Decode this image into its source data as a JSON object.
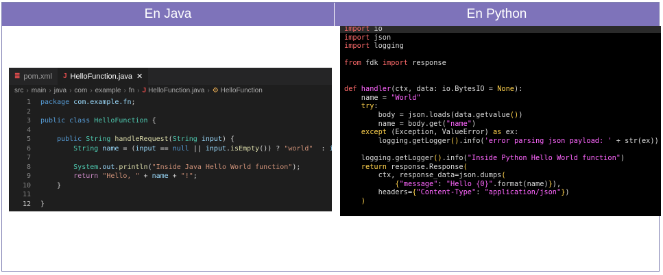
{
  "header": {
    "left_title": "En Java",
    "right_title": "En Python"
  },
  "java": {
    "tabs": [
      {
        "icon": "xml-file-icon",
        "glyph": "≣",
        "label": "pom.xml",
        "color": "#e44d4d"
      },
      {
        "icon": "java-file-icon",
        "glyph": "J",
        "label": "HelloFunction.java",
        "color": "#e44d4d"
      }
    ],
    "close_glyph": "✕",
    "breadcrumb": [
      "src",
      "main",
      "java",
      "com",
      "example",
      "fn",
      "HelloFunction.java",
      "HelloFunction"
    ],
    "current_line": 12,
    "lines": [
      {
        "num": "1",
        "tokens": [
          {
            "t": "package ",
            "c": "#569cd6"
          },
          {
            "t": "com.example.fn",
            "c": "#9cdcfe"
          },
          {
            "t": ";",
            "c": "#d4d4d4"
          }
        ]
      },
      {
        "num": "2",
        "tokens": []
      },
      {
        "num": "3",
        "tokens": [
          {
            "t": "public class ",
            "c": "#569cd6"
          },
          {
            "t": "HelloFunction",
            "c": "#4ec9b0"
          },
          {
            "t": " {",
            "c": "#d4d4d4"
          }
        ]
      },
      {
        "num": "4",
        "tokens": []
      },
      {
        "num": "5",
        "tokens": [
          {
            "t": "    public ",
            "c": "#569cd6"
          },
          {
            "t": "String ",
            "c": "#4ec9b0"
          },
          {
            "t": "handleRequest",
            "c": "#dcdcaa"
          },
          {
            "t": "(",
            "c": "#d4d4d4"
          },
          {
            "t": "String ",
            "c": "#4ec9b0"
          },
          {
            "t": "input",
            "c": "#9cdcfe"
          },
          {
            "t": ") {",
            "c": "#d4d4d4"
          }
        ]
      },
      {
        "num": "6",
        "tokens": [
          {
            "t": "        String ",
            "c": "#4ec9b0"
          },
          {
            "t": "name",
            "c": "#9cdcfe"
          },
          {
            "t": " = (",
            "c": "#d4d4d4"
          },
          {
            "t": "input",
            "c": "#9cdcfe"
          },
          {
            "t": " == ",
            "c": "#d4d4d4"
          },
          {
            "t": "null",
            "c": "#569cd6"
          },
          {
            "t": " || ",
            "c": "#d4d4d4"
          },
          {
            "t": "input",
            "c": "#9cdcfe"
          },
          {
            "t": ".",
            "c": "#d4d4d4"
          },
          {
            "t": "isEmpty",
            "c": "#dcdcaa"
          },
          {
            "t": "()) ? ",
            "c": "#d4d4d4"
          },
          {
            "t": "\"world\"",
            "c": "#ce9178"
          },
          {
            "t": "  : ",
            "c": "#d4d4d4"
          },
          {
            "t": "input",
            "c": "#9cdcfe"
          },
          {
            "t": ";",
            "c": "#d4d4d4"
          }
        ]
      },
      {
        "num": "7",
        "tokens": []
      },
      {
        "num": "8",
        "tokens": [
          {
            "t": "        System",
            "c": "#4ec9b0"
          },
          {
            "t": ".",
            "c": "#d4d4d4"
          },
          {
            "t": "out",
            "c": "#9cdcfe"
          },
          {
            "t": ".",
            "c": "#d4d4d4"
          },
          {
            "t": "println",
            "c": "#dcdcaa"
          },
          {
            "t": "(",
            "c": "#d4d4d4"
          },
          {
            "t": "\"Inside Java Hello World function\"",
            "c": "#ce9178"
          },
          {
            "t": ");",
            "c": "#d4d4d4"
          }
        ]
      },
      {
        "num": "9",
        "tokens": [
          {
            "t": "        return ",
            "c": "#c586c0"
          },
          {
            "t": "\"Hello, \"",
            "c": "#ce9178"
          },
          {
            "t": " + ",
            "c": "#d4d4d4"
          },
          {
            "t": "name",
            "c": "#9cdcfe"
          },
          {
            "t": " + ",
            "c": "#d4d4d4"
          },
          {
            "t": "\"!\"",
            "c": "#ce9178"
          },
          {
            "t": ";",
            "c": "#d4d4d4"
          }
        ]
      },
      {
        "num": "10",
        "tokens": [
          {
            "t": "    }",
            "c": "#d4d4d4"
          }
        ]
      },
      {
        "num": "11",
        "tokens": []
      },
      {
        "num": "12",
        "tokens": [
          {
            "t": "}",
            "c": "#d4d4d4"
          }
        ]
      }
    ]
  },
  "python": {
    "lines": [
      [
        {
          "t": "import",
          "c": "#ff6b6b"
        },
        {
          "t": " io",
          "c": "#d9d9d9"
        }
      ],
      [
        {
          "t": "import",
          "c": "#ff6b6b"
        },
        {
          "t": " json",
          "c": "#d9d9d9"
        }
      ],
      [
        {
          "t": "import",
          "c": "#ff6b6b"
        },
        {
          "t": " logging",
          "c": "#d9d9d9"
        }
      ],
      [],
      [
        {
          "t": "from",
          "c": "#ff6b6b"
        },
        {
          "t": " fdk ",
          "c": "#d9d9d9"
        },
        {
          "t": "import",
          "c": "#ff6b6b"
        },
        {
          "t": " response",
          "c": "#d9d9d9"
        }
      ],
      [],
      [],
      [
        {
          "t": "def",
          "c": "#ff6b6b"
        },
        {
          "t": " handler",
          "c": "#ff66ff"
        },
        {
          "t": "(ctx, data: io.BytesIO = ",
          "c": "#d9d9d9"
        },
        {
          "t": "None",
          "c": "#ffd24d"
        },
        {
          "t": "):",
          "c": "#d9d9d9"
        }
      ],
      [
        {
          "t": "    name = ",
          "c": "#d9d9d9"
        },
        {
          "t": "\"World\"",
          "c": "#ff66ff"
        }
      ],
      [
        {
          "t": "    try",
          "c": "#ffd24d"
        },
        {
          "t": ":",
          "c": "#d9d9d9"
        }
      ],
      [
        {
          "t": "        body = json.loads(data.getvalue",
          "c": "#d9d9d9"
        },
        {
          "t": "()",
          "c": "#ffd24d"
        },
        {
          "t": ")",
          "c": "#d9d9d9"
        }
      ],
      [
        {
          "t": "        name = body.get(",
          "c": "#d9d9d9"
        },
        {
          "t": "\"name\"",
          "c": "#ff66ff"
        },
        {
          "t": ")",
          "c": "#d9d9d9"
        }
      ],
      [
        {
          "t": "    except",
          "c": "#ffd24d"
        },
        {
          "t": " (Exception, ValueError) ",
          "c": "#d9d9d9"
        },
        {
          "t": "as",
          "c": "#ffd24d"
        },
        {
          "t": " ex:",
          "c": "#d9d9d9"
        }
      ],
      [
        {
          "t": "        logging.getLogger",
          "c": "#d9d9d9"
        },
        {
          "t": "()",
          "c": "#ffd24d"
        },
        {
          "t": ".info(",
          "c": "#d9d9d9"
        },
        {
          "t": "'error parsing json payload: '",
          "c": "#ff66ff"
        },
        {
          "t": " + str(ex))",
          "c": "#d9d9d9"
        }
      ],
      [],
      [
        {
          "t": "    logging.getLogger",
          "c": "#d9d9d9"
        },
        {
          "t": "()",
          "c": "#ffd24d"
        },
        {
          "t": ".info(",
          "c": "#d9d9d9"
        },
        {
          "t": "\"Inside Python Hello World function\"",
          "c": "#ff66ff"
        },
        {
          "t": ")",
          "c": "#d9d9d9"
        }
      ],
      [
        {
          "t": "    return",
          "c": "#ffd24d"
        },
        {
          "t": " response.Response",
          "c": "#d9d9d9"
        },
        {
          "t": "(",
          "c": "#ffd24d"
        }
      ],
      [
        {
          "t": "        ctx, response_data=json.dumps",
          "c": "#d9d9d9"
        },
        {
          "t": "(",
          "c": "#ffd24d"
        }
      ],
      [
        {
          "t": "            {",
          "c": "#ffd24d"
        },
        {
          "t": "\"message\"",
          "c": "#ff66ff"
        },
        {
          "t": ": ",
          "c": "#d9d9d9"
        },
        {
          "t": "\"Hello {0}\"",
          "c": "#ff66ff"
        },
        {
          "t": ".format(name)",
          "c": "#d9d9d9"
        },
        {
          "t": "}",
          "c": "#ffd24d"
        },
        {
          "t": "),",
          "c": "#d9d9d9"
        }
      ],
      [
        {
          "t": "        headers=",
          "c": "#d9d9d9"
        },
        {
          "t": "{",
          "c": "#ffd24d"
        },
        {
          "t": "\"Content-Type\"",
          "c": "#ff66ff"
        },
        {
          "t": ": ",
          "c": "#d9d9d9"
        },
        {
          "t": "\"application/json\"",
          "c": "#ff66ff"
        },
        {
          "t": "}",
          "c": "#ffd24d"
        },
        {
          "t": ")",
          "c": "#d9d9d9"
        }
      ],
      [
        {
          "t": "    )",
          "c": "#ffd24d"
        }
      ]
    ]
  }
}
